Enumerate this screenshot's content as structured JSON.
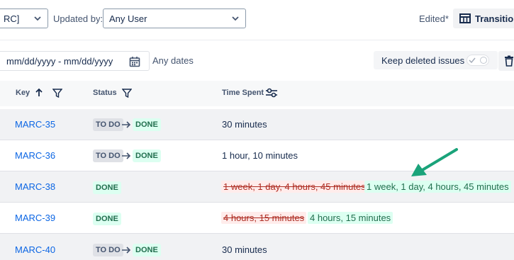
{
  "filters": {
    "project_value": "RC]",
    "updated_by_label": "Updated by:",
    "updated_by_value": "Any User",
    "edited_label": "Edited*",
    "transition_button": "Transition",
    "date_placeholder": "mm/dd/yyyy - mm/dd/yyyy",
    "any_dates_label": "Any dates",
    "keep_deleted_label": "Keep deleted issues"
  },
  "table": {
    "headers": {
      "key": "Key",
      "status": "Status",
      "time_spent": "Time Spent"
    },
    "rows": [
      {
        "key": "MARC-35",
        "from": "TO DO",
        "to": "DONE",
        "time": "30 minutes"
      },
      {
        "key": "MARC-36",
        "from": "TO DO",
        "to": "DONE",
        "time": "1 hour, 10 minutes"
      },
      {
        "key": "MARC-38",
        "to": "DONE",
        "old_time": "1 week, 1 day, 4 hours, 45 minutes",
        "new_time": "1 week, 1 day, 4 hours, 45 minutes"
      },
      {
        "key": "MARC-39",
        "to": "DONE",
        "old_time": "4 hours, 15 minutes",
        "new_time": "4 hours, 15 minutes"
      },
      {
        "key": "MARC-40",
        "from": "TO DO",
        "to": "DONE",
        "time": "30 minutes"
      }
    ]
  },
  "icons": {
    "chevron": "chevron-down-icon",
    "calendar": "calendar-icon",
    "table": "table-icon",
    "trash": "trash-icon",
    "sort": "arrow-up-icon",
    "filter": "filter-icon",
    "settings": "sliders-icon",
    "transition": "arrow-right-icon",
    "annotation": "annotation-arrow-icon"
  },
  "colors": {
    "link": "#0c66e4",
    "done_bg": "#dcfff1",
    "done_text": "#216e4e",
    "todo_bg": "#dfe1e6",
    "removed_text": "#ae2e24",
    "removed_bg": "#ffeceb",
    "annotation": "#1aa37a"
  }
}
